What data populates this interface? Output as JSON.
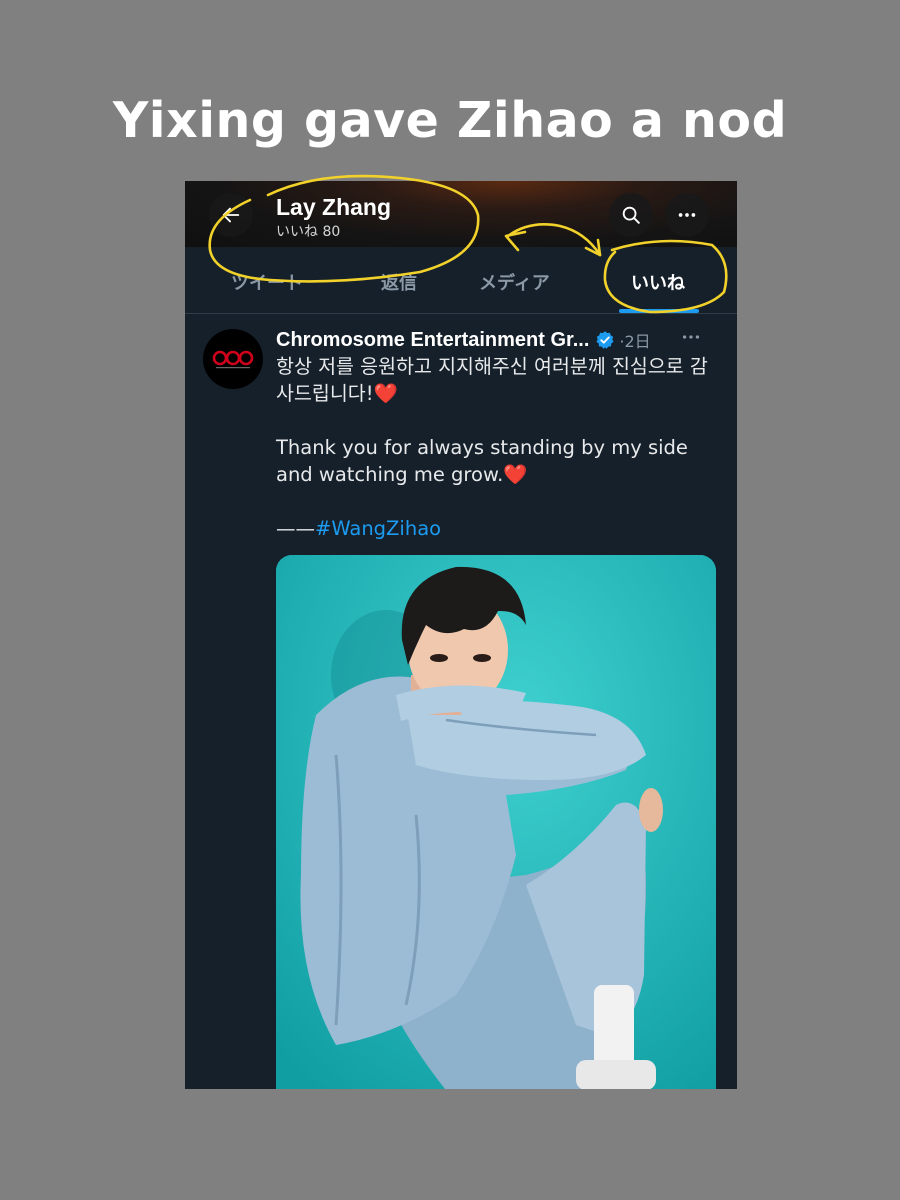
{
  "caption": "Yixing gave Zihao a nod",
  "header": {
    "name": "Lay Zhang",
    "subtitle": "いいね 80"
  },
  "icons": {
    "back": "arrow-left-icon",
    "search": "search-icon",
    "more": "more-horizontal-icon",
    "verified": "verified-badge-icon",
    "heart": "red-heart-emoji"
  },
  "tabs": [
    {
      "label": "ツイート",
      "active": false
    },
    {
      "label": "返信",
      "active": false
    },
    {
      "label": "メディア",
      "active": false
    },
    {
      "label": "いいね",
      "active": true
    }
  ],
  "post": {
    "author": "Chromosome Entertainment Gr...",
    "time": "·2日",
    "text_ko": "항상 저를 응원하고 지지해주신 여러분께 진심으로 감사드립니다!",
    "heart": "❤️",
    "text_en": "Thank you for always standing by my side and watching me grow.",
    "dash": "——",
    "hashtag": "#WangZihao"
  },
  "colors": {
    "background": "#808080",
    "app_bg": "#15202b",
    "accent": "#1d9bf0",
    "annotation": "#f2d22a",
    "photo_bg": "#22b3b5"
  }
}
